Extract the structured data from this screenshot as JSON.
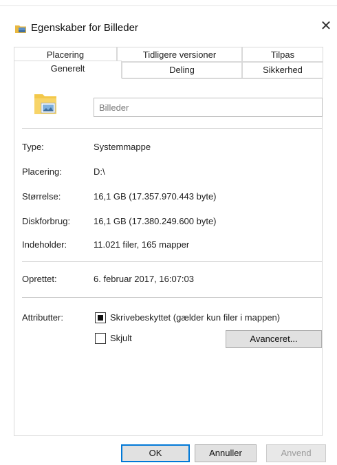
{
  "window": {
    "title": "Egenskaber for Billeder"
  },
  "tabs_back": [
    "Placering",
    "Tidligere versioner",
    "Tilpas"
  ],
  "tabs_front": [
    "Generelt",
    "Deling",
    "Sikkerhed"
  ],
  "general": {
    "name_value": "Billeder",
    "rows": [
      {
        "label": "Type:",
        "value": "Systemmappe"
      },
      {
        "label": "Placering:",
        "value": "D:\\"
      },
      {
        "label": "Størrelse:",
        "value": "16,1 GB (17.357.970.443 byte)"
      },
      {
        "label": "Diskforbrug:",
        "value": "16,1 GB (17.380.249.600 byte)"
      },
      {
        "label": "Indeholder:",
        "value": "11.021 filer, 165 mapper"
      }
    ],
    "created": {
      "label": "Oprettet:",
      "value": "6. februar 2017, 16:07:03"
    },
    "attributes": {
      "label": "Attributter:",
      "readonly_label": "Skrivebeskyttet (gælder kun filer i mappen)",
      "hidden_label": "Skjult",
      "advanced_button": "Avanceret..."
    }
  },
  "buttons": {
    "ok": "OK",
    "cancel": "Annuller",
    "apply": "Anvend"
  },
  "colors": {
    "accent": "#0078d7",
    "folder": "#f3c84a"
  }
}
